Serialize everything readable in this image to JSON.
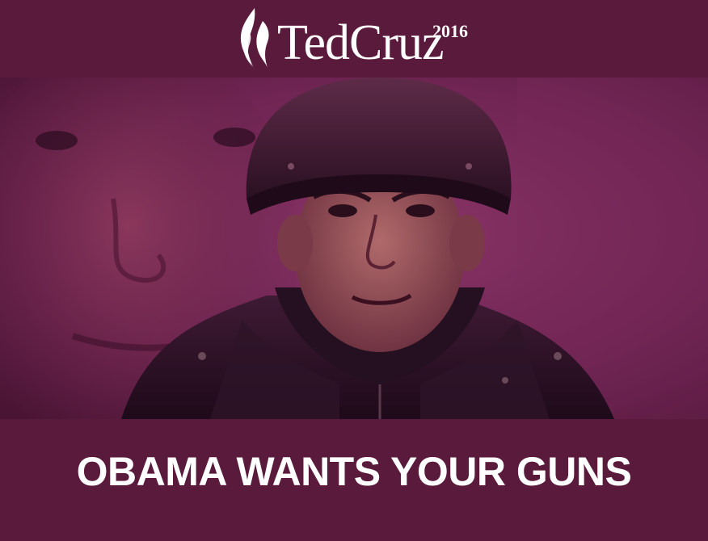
{
  "header": {
    "logo_name": "TedCruz",
    "logo_year": "2016",
    "logo_mark_icon": "flame-logo-icon"
  },
  "photo": {
    "subject_icon": "portrait-photo",
    "tint_color": "#7a2a5a"
  },
  "caption": {
    "headline": "OBAMA WANTS YOUR GUNS"
  },
  "colors": {
    "background": "#5a1a3c",
    "text": "#ffffff"
  }
}
